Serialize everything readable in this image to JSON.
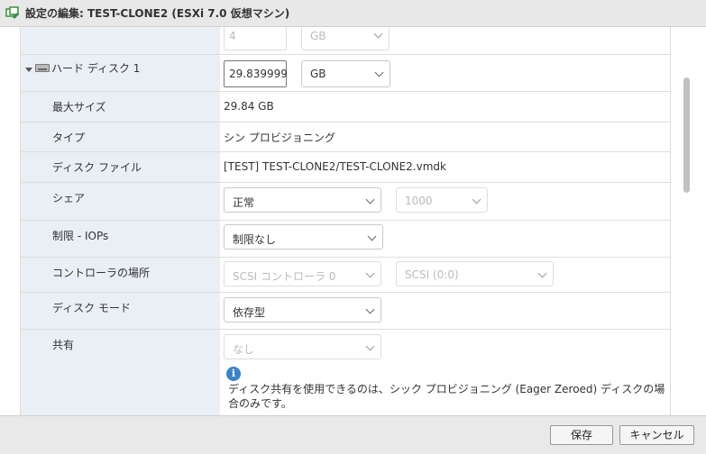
{
  "window": {
    "title": "設定の編集: TEST-CLONE2 (ESXi 7.0 仮想マシン)"
  },
  "partial_row": {
    "value": "4",
    "unit": "GB"
  },
  "hard_disk": {
    "label": "ハード ディスク 1",
    "size_value": "29.839999",
    "size_unit": "GB"
  },
  "rows": {
    "max_size": {
      "label": "最大サイズ",
      "value": "29.84 GB"
    },
    "type": {
      "label": "タイプ",
      "value": "シン プロビジョニング"
    },
    "disk_file": {
      "label": "ディスク ファイル",
      "value": "[TEST] TEST-CLONE2/TEST-CLONE2.vmdk"
    },
    "shares": {
      "label": "シェア",
      "select": "正常",
      "number": "1000"
    },
    "limit_iops": {
      "label": "制限 - IOPs",
      "select": "制限なし"
    },
    "controller": {
      "label": "コントローラの場所",
      "select": "SCSI コントローラ 0",
      "slot": "SCSI (0:0)"
    },
    "disk_mode": {
      "label": "ディスク モード",
      "select": "依存型"
    },
    "sharing": {
      "label": "共有",
      "select": "なし",
      "info": "ディスク共有を使用できるのは、シック プロビジョニング (Eager Zeroed) ディスクの場合のみです。"
    }
  },
  "footer": {
    "save_label": "保存",
    "cancel_label": "キャンセル"
  },
  "colors": {
    "label_bg": "#e9eff4",
    "info_blue": "#3a83c6"
  }
}
